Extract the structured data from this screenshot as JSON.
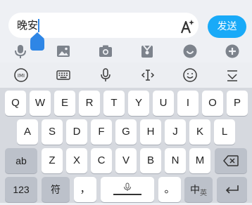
{
  "chat": {
    "input_value": "晚安",
    "send_label": "发送"
  },
  "attachments": [
    "mic-icon",
    "image-icon",
    "camera-icon",
    "gift-icon",
    "emoji-icon",
    "plus-icon"
  ],
  "keyboard": {
    "toolbar": [
      "ime-logo-icon",
      "keyboard-icon",
      "mic-icon",
      "cursor-icon",
      "emoji-icon",
      "collapse-icon"
    ],
    "row1": [
      "Q",
      "W",
      "E",
      "R",
      "T",
      "Y",
      "U",
      "I",
      "O",
      "P"
    ],
    "row2": [
      "A",
      "S",
      "D",
      "F",
      "G",
      "H",
      "J",
      "K",
      "L"
    ],
    "row3": [
      "Z",
      "X",
      "C",
      "V",
      "B",
      "N",
      "M"
    ],
    "shift_label": "ab",
    "num_label": "123",
    "symbol_label": "符",
    "comma_label": "，",
    "period_label": "。",
    "lang_label": "中",
    "lang_sub_label": "英"
  },
  "colors": {
    "accent": "#19aaf8",
    "caret": "#2e86e6",
    "keyboard_bg": "#d6d9df"
  }
}
